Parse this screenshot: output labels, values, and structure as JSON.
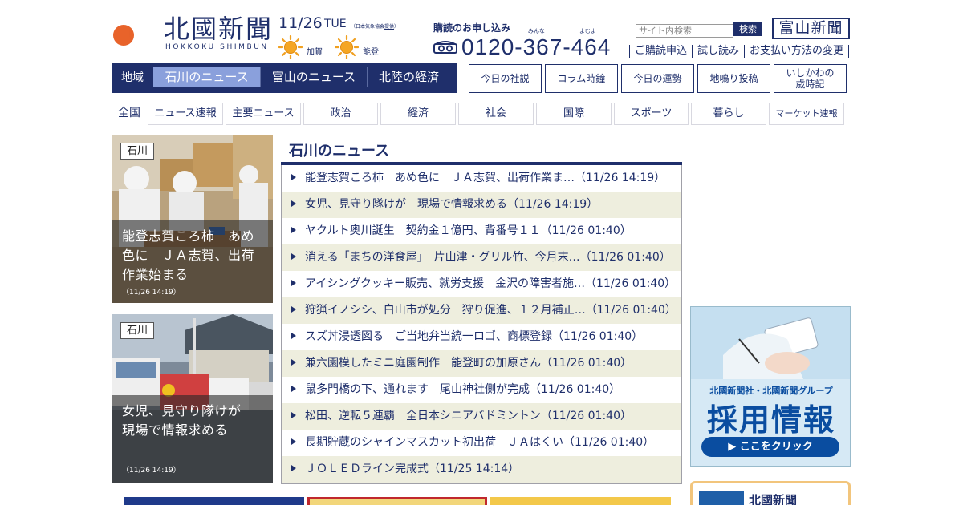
{
  "header": {
    "logo_title": "北國新聞",
    "logo_sub": "HOKKOKU SHIMBUN",
    "weather": {
      "date": "11/26",
      "dow": "TUE",
      "source_prefix": "（日本気象協会",
      "source_link": "提供",
      "source_suffix": "）",
      "cities": [
        "加賀",
        "能登"
      ]
    },
    "subscribe": {
      "title": "購読のお申し込み",
      "ruby": [
        "みんな",
        "よむよ"
      ],
      "phone": "0120-367-464"
    },
    "search": {
      "placeholder": "サイト内検索",
      "button": "検索"
    },
    "toyama_logo": "富山新聞",
    "top_links": [
      "ご購読申込",
      "試し読み",
      "お支払い方法の変更"
    ]
  },
  "region": {
    "label": "地域",
    "tabs": [
      "石川のニュース",
      "富山のニュース",
      "北陸の経済"
    ],
    "active": 0
  },
  "features": [
    "今日の社説",
    "コラム時鐘",
    "今日の運勢",
    "地鳴り投稿",
    "いしかわの",
    "歳時記"
  ],
  "categories": [
    "全国",
    "ニュース速報",
    "主要ニュース",
    "政治",
    "経済",
    "社会",
    "国際",
    "スポーツ",
    "暮らし",
    "マーケット速報"
  ],
  "photo_cards": [
    {
      "tag": "石川",
      "title": "能登志賀ころ柿　あめ色に　ＪＡ志賀、出荷作業始まる",
      "time": "（11/26 14:19）"
    },
    {
      "tag": "石川",
      "title": "女児、見守り隊けが　現場で情報求める",
      "time": "（11/26 14:19）"
    }
  ],
  "news": {
    "heading": "石川のニュース",
    "items": [
      {
        "title": "能登志賀ころ柿　あめ色に　ＪＡ志賀、出荷作業ま…",
        "date": "（11/26 14:19）"
      },
      {
        "title": "女児、見守り隊けが　現場で情報求める",
        "date": "（11/26 14:19）"
      },
      {
        "title": "ヤクルト奥川誕生　契約金１億円、背番号１１",
        "date": "（11/26 01:40）"
      },
      {
        "title": "消える「まちの洋食屋」　片山津・グリル竹、今月末…",
        "date": "（11/26 01:40）"
      },
      {
        "title": "アイシングクッキー販売、就労支援　金沢の障害者施…",
        "date": "（11/26 01:40）"
      },
      {
        "title": "狩猟イノシシ、白山市が処分　狩り促進、１２月補正…",
        "date": "（11/26 01:40）"
      },
      {
        "title": "スズ丼浸透図る　ご当地弁当統一ロゴ、商標登録",
        "date": "（11/26 01:40）"
      },
      {
        "title": "兼六園模したミニ庭園制作　能登町の加原さん",
        "date": "（11/26 01:40）"
      },
      {
        "title": "鼠多門橋の下、通れます　尾山神社側が完成",
        "date": "（11/26 01:40）"
      },
      {
        "title": "松田、逆転５連覇　全日本シニアバドミントン",
        "date": "（11/26 01:40）"
      },
      {
        "title": "長期貯蔵のシャインマスカット初出荷　ＪＡはくい",
        "date": "（11/26 01:40）"
      },
      {
        "title": "ＪＯＬＥＤライン完成式",
        "date": "（11/25 14:14）"
      }
    ]
  },
  "recruit_ad": {
    "small": "北國新聞社・北國新聞グループ",
    "big": "採用情報",
    "button": "▶ ここをクリック"
  },
  "side_panel": {
    "name": "北國新聞"
  },
  "colors": {
    "navy": "#1f2f6b",
    "active_tab": "#8aa0dc",
    "stripe": "#eeeede",
    "recruit_blue": "#0a4da0"
  }
}
